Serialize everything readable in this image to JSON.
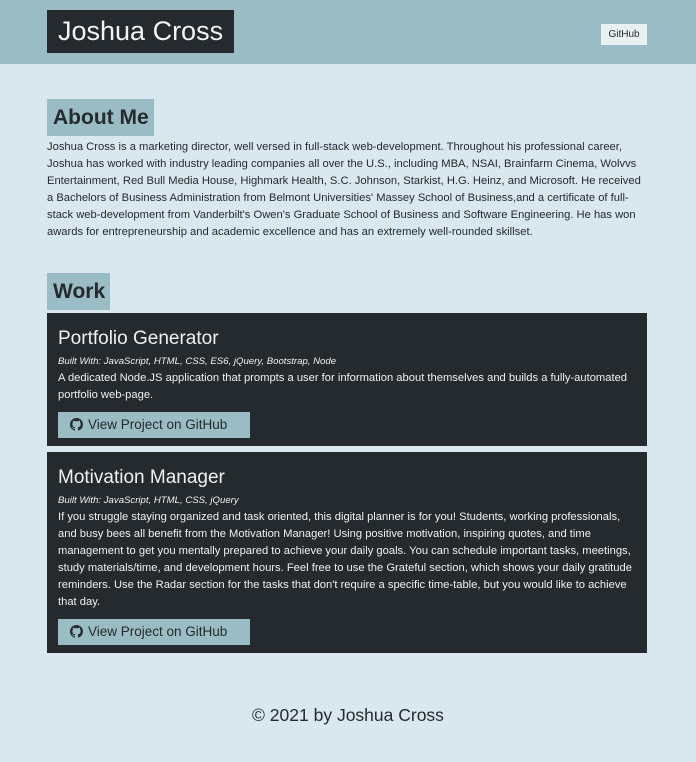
{
  "header": {
    "name": "Joshua Cross",
    "github_link": "GitHub"
  },
  "about": {
    "heading": "About Me",
    "text": "Joshua Cross is a marketing director, well versed in full-stack web-development. Throughout his professional career, Joshua has worked with industry leading companies all over the U.S., including MBA, NSAI, Brainfarm Cinema, Wolvvs Entertainment, Red Bull Media House, Highmark Health, S.C. Johnson, Starkist, H.G. Heinz, and Microsoft. He received a Bachelors of Business Administration from Belmont Universities' Massey School of Business,and a certificate of full-stack web-development from Vanderbilt's Owen's Graduate School of Business and Software Engineering. He has won awards for entrepreneurship and academic excellence and has an extremely well-rounded skillset."
  },
  "work": {
    "heading": "Work",
    "projects": [
      {
        "title": "Portfolio Generator",
        "built_with": "Built With: JavaScript, HTML, CSS, ES6, jQuery, Bootstrap, Node",
        "description": "A dedicated Node.JS application that prompts a user for information about themselves and builds a fully-automated portfolio web-page.",
        "button_label": "View Project on GitHub",
        "button_icon": "github-icon"
      },
      {
        "title": "Motivation Manager",
        "built_with": "Built With: JavaScript, HTML, CSS, jQuery",
        "description": "If you struggle staying organized and task oriented, this digital planner is for you! Students, working professionals, and busy bees all benefit from the Motivation Manager! Using positive motivation, inspiring quotes, and time management to get you mentally prepared to achieve your daily goals. You can schedule important tasks, meetings, study materials/time, and development hours. Feel free to use the Grateful section, which shows your daily gratitude reminders. Use the Radar section for the tasks that don't require a specific time-table, but you would like to achieve that day.",
        "button_label": "View Project on GitHub",
        "button_icon": "github-icon"
      }
    ]
  },
  "footer": {
    "text": "© 2021 by Joshua Cross"
  },
  "colors": {
    "background": "#d9e7ee",
    "accent": "#9abcc4",
    "dark": "#252a2e"
  }
}
